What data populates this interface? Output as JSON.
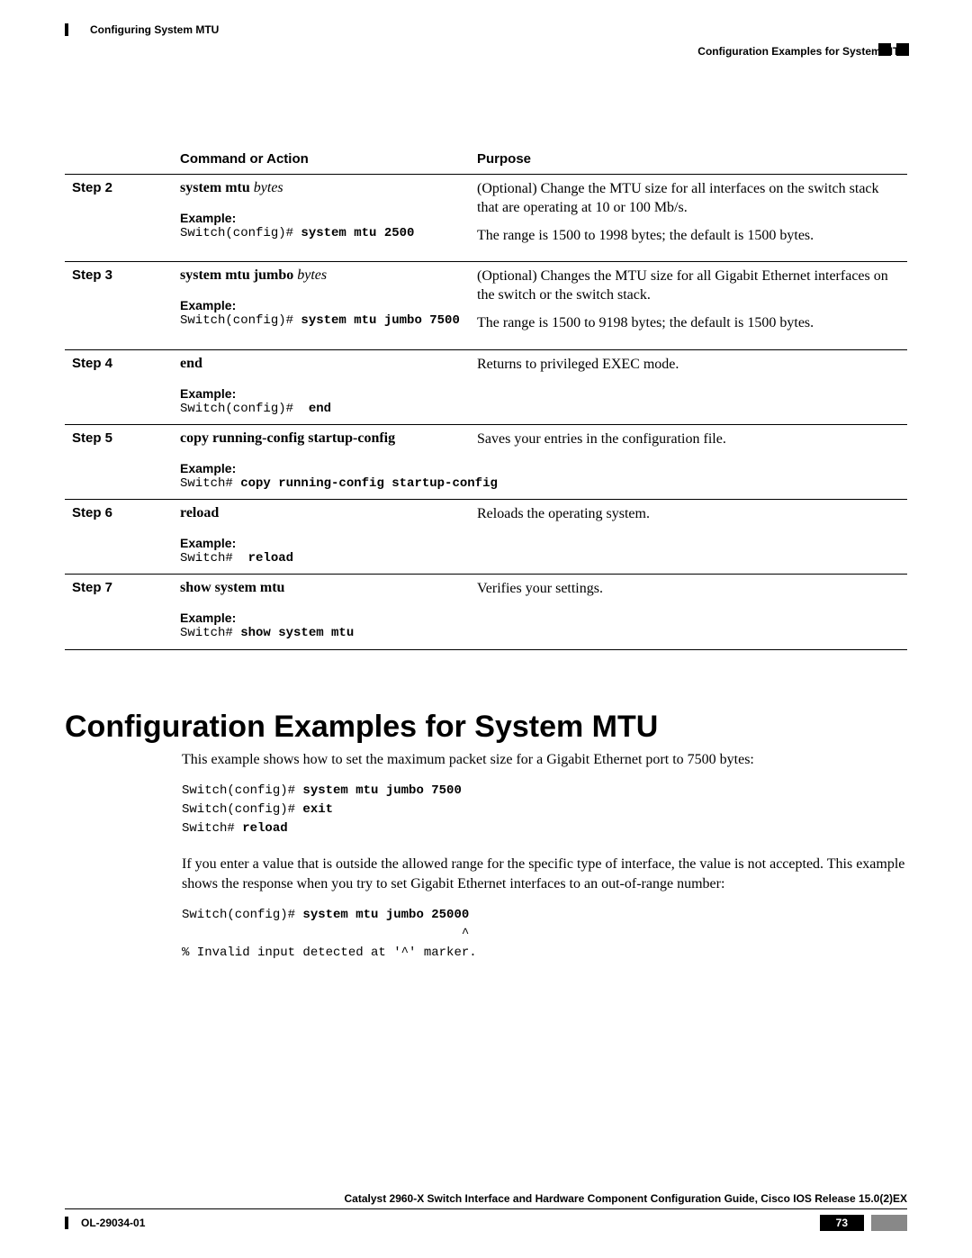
{
  "header": {
    "chapter": "Configuring System MTU",
    "section": "Configuration Examples for System MTU"
  },
  "table": {
    "head": {
      "col1": "",
      "col2": "Command or Action",
      "col3": "Purpose"
    },
    "example_label": "Example:",
    "steps": [
      {
        "step": "Step 2",
        "cmd_bold": "system mtu ",
        "cmd_ital": "bytes",
        "ex_plain": "Switch(config)# ",
        "ex_bold": "system mtu 2500",
        "purpose": [
          "(Optional) Change the MTU size for all interfaces on the switch stack that are operating at 10 or 100 Mb/s.",
          "The range is 1500 to 1998 bytes; the default is 1500 bytes."
        ]
      },
      {
        "step": "Step 3",
        "cmd_bold": "system mtu jumbo ",
        "cmd_ital": "bytes",
        "ex_plain": "Switch(config)# ",
        "ex_bold": "system mtu jumbo 7500",
        "purpose": [
          "(Optional) Changes the MTU size for all Gigabit Ethernet interfaces on the switch or the switch stack.",
          "The range is 1500 to 9198 bytes; the default is 1500 bytes."
        ]
      },
      {
        "step": "Step 4",
        "cmd_bold": "end",
        "cmd_ital": "",
        "ex_plain": "Switch(config)#  ",
        "ex_bold": "end",
        "purpose": [
          "Returns to privileged EXEC mode."
        ]
      },
      {
        "step": "Step 5",
        "cmd_bold": "copy running-config startup-config",
        "cmd_ital": "",
        "ex_plain": "Switch# ",
        "ex_bold": "copy running-config startup-config",
        "purpose": [
          "Saves your entries in the configuration file."
        ]
      },
      {
        "step": "Step 6",
        "cmd_bold": "reload",
        "cmd_ital": "",
        "ex_plain": "Switch#  ",
        "ex_bold": "reload",
        "purpose": [
          "Reloads the operating system."
        ]
      },
      {
        "step": "Step 7",
        "cmd_bold": "show system mtu",
        "cmd_ital": "",
        "ex_plain": "Switch# ",
        "ex_bold": "show system mtu",
        "purpose": [
          "Verifies your settings."
        ]
      }
    ]
  },
  "body": {
    "heading": "Configuration Examples for System MTU",
    "p1": "This example shows how to set the maximum packet size for a Gigabit Ethernet port to 7500 bytes:",
    "code1": {
      "l1p": "Switch(config)# ",
      "l1b": "system mtu jumbo 7500",
      "l2p": "Switch(config)# ",
      "l2b": "exit",
      "l3p": "Switch# ",
      "l3b": "reload"
    },
    "p2": "If you enter a value that is outside the allowed range for the specific type of interface, the value is not accepted. This example shows the response when you try to set Gigabit Ethernet interfaces to an out-of-range number:",
    "code2": {
      "l1p": "Switch(config)# ",
      "l1b": "system mtu jumbo 25000",
      "l2": "                                     ^",
      "l3": "% Invalid input detected at '^' marker."
    }
  },
  "footer": {
    "title": "Catalyst 2960-X Switch Interface and Hardware Component Configuration Guide, Cisco IOS Release 15.0(2)EX",
    "doc": "OL-29034-01",
    "page": "73"
  }
}
